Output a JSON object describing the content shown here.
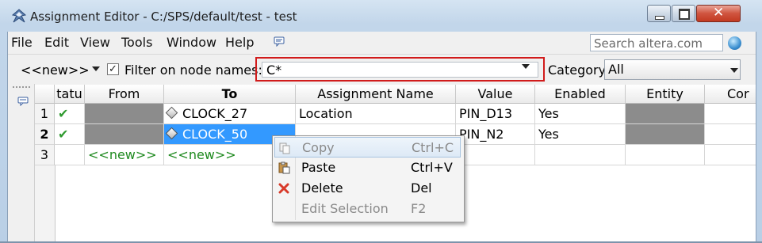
{
  "window": {
    "title": "Assignment Editor - C:/SPS/default/test - test"
  },
  "menubar": {
    "items": [
      "File",
      "Edit",
      "View",
      "Tools",
      "Window",
      "Help"
    ],
    "search_placeholder": "Search altera.com"
  },
  "filterbar": {
    "new_combo_value": "<<new>>",
    "filter_checked": true,
    "filter_label": "Filter on node names:",
    "node_value": "C*",
    "category_label": "Category:",
    "category_value": "All"
  },
  "grid": {
    "columns": [
      "tatu",
      "From",
      "To",
      "Assignment Name",
      "Value",
      "Enabled",
      "Entity",
      "Cor"
    ],
    "rows": [
      {
        "num": "1",
        "status": "✔",
        "from": "",
        "to": "CLOCK_27",
        "assignment": "Location",
        "value": "PIN_D13",
        "enabled": "Yes"
      },
      {
        "num": "2",
        "status": "✔",
        "from": "",
        "to": "CLOCK_50",
        "assignment": "",
        "value": "PIN_N2",
        "enabled": "Yes"
      },
      {
        "num": "3",
        "status": "",
        "from": "<<new>>",
        "to": "<<new>>",
        "assignment": "",
        "value": "",
        "enabled": ""
      }
    ]
  },
  "context_menu": {
    "items": [
      {
        "label": "Copy",
        "shortcut": "Ctrl+C",
        "enabled": false,
        "icon": "copy-icon"
      },
      {
        "label": "Paste",
        "shortcut": "Ctrl+V",
        "enabled": true,
        "icon": "paste-icon"
      },
      {
        "label": "Delete",
        "shortcut": "Del",
        "enabled": true,
        "icon": "delete-icon"
      },
      {
        "label": "Edit Selection",
        "shortcut": "F2",
        "enabled": false,
        "icon": ""
      }
    ]
  },
  "colors": {
    "selection": "#3399ff",
    "highlight_border": "#d11b1b",
    "new_text": "#1f8a1f",
    "check": "#2f9a2f"
  }
}
